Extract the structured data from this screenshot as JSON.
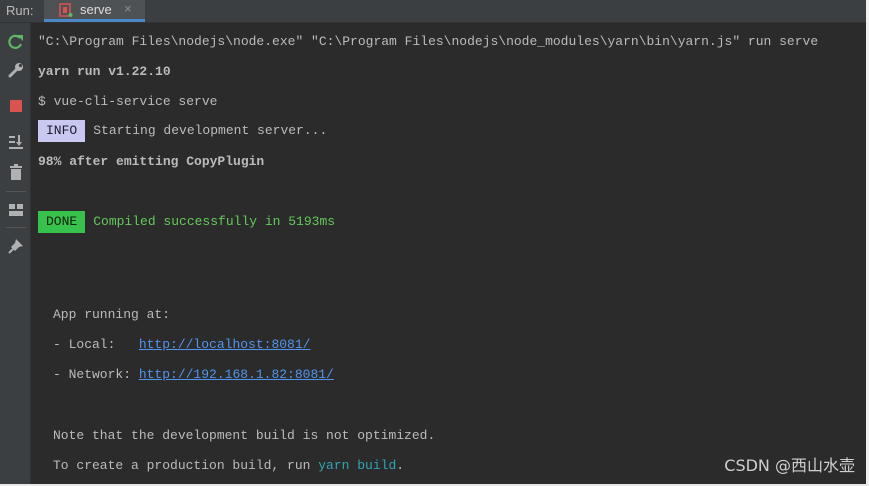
{
  "tabbar": {
    "run_label": "Run:",
    "tab": {
      "label": "serve",
      "close": "×",
      "icon": "npm-run-icon"
    }
  },
  "toolbar": {
    "buttons": [
      {
        "name": "rerun-icon",
        "color": "#5fb563"
      },
      {
        "name": "wrench-icon",
        "color": "#afb1b3"
      },
      {
        "name": "stop-icon",
        "color": "#d9534f"
      },
      {
        "name": "scroll-to-end-icon",
        "color": "#afb1b3"
      },
      {
        "name": "trash-icon",
        "color": "#afb1b3"
      },
      {
        "name": "layout-icon",
        "color": "#afb1b3"
      },
      {
        "name": "pin-icon",
        "color": "#afb1b3"
      }
    ]
  },
  "console": {
    "cmd": "\"C:\\Program Files\\nodejs\\node.exe\" \"C:\\Program Files\\nodejs\\node_modules\\yarn\\bin\\yarn.js\" run serve",
    "yarn_version": "yarn run v1.22.10",
    "vue_cmd": "$ vue-cli-service serve",
    "info_badge": "INFO",
    "info_text": "Starting development server...",
    "progress": "98% after emitting CopyPlugin",
    "done_badge": "DONE",
    "done_text": "Compiled successfully in 5193ms",
    "app_running": "App running at:",
    "local_label": "- Local:   ",
    "local_url": "http://localhost:8081/",
    "network_label": "- Network: ",
    "network_url": "http://192.168.1.82:8081/",
    "note": "Note that the development build is not optimized.",
    "prod_prefix": "To create a production build, run ",
    "prod_cmd": "yarn build",
    "prod_suffix": "."
  },
  "watermark": "CSDN @西山水壶",
  "colors": {
    "background": "#2b2b2b",
    "info_badge": "#c9c8f0",
    "done_badge": "#37c24b",
    "success_text": "#64c85a",
    "link": "#5394ec",
    "command": "#31a4b4"
  }
}
